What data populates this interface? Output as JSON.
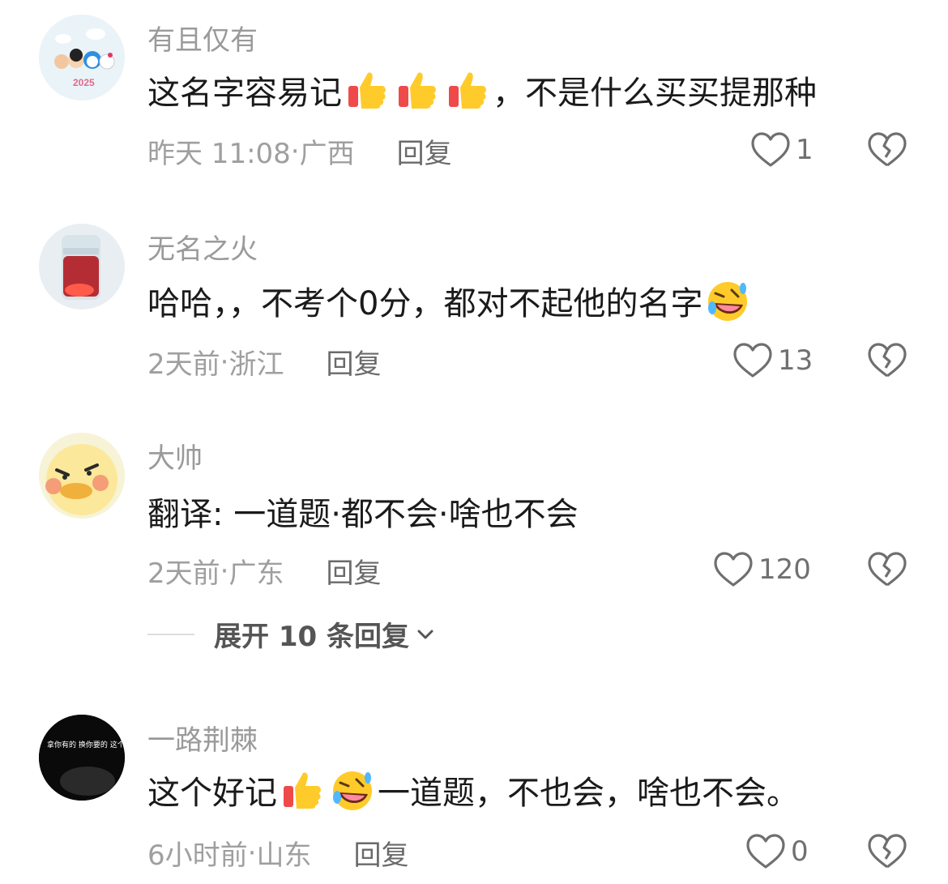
{
  "comments": [
    {
      "username": "有且仅有",
      "text_before": "这名字容易记",
      "emojis_mid": [
        "thumbs-up",
        "thumbs-up",
        "thumbs-up"
      ],
      "text_after": "，不是什么买买提那种",
      "time": "昨天 11:08",
      "location": "广西",
      "reply_label": "回复",
      "likes": "1"
    },
    {
      "username": "无名之火",
      "text_before": "哈哈，，不考个0分，都对不起他的名字",
      "emojis_end": [
        "rolling-laugh"
      ],
      "time": "2天前",
      "location": "浙江",
      "reply_label": "回复",
      "likes": "13"
    },
    {
      "username": "大帅",
      "text_before": "翻译: 一道题·都不会·啥也不会",
      "time": "2天前",
      "location": "广东",
      "reply_label": "回复",
      "likes": "120"
    },
    {
      "username": "一路荆棘",
      "text_before": "这个好记",
      "text_after": "一道题，不也会，啥也不会。",
      "time": "6小时前",
      "location": "山东",
      "reply_label": "回复",
      "likes": "0"
    }
  ],
  "expand_replies": {
    "label": "展开 10 条回复"
  },
  "avatar_text": {
    "c4": "拿你有的 换你要的 这个世界一直如此"
  },
  "separator": " · ",
  "colors": {
    "text": "#1a1a1a",
    "muted": "#9f9f9f",
    "icon": "#6f6f6f"
  }
}
